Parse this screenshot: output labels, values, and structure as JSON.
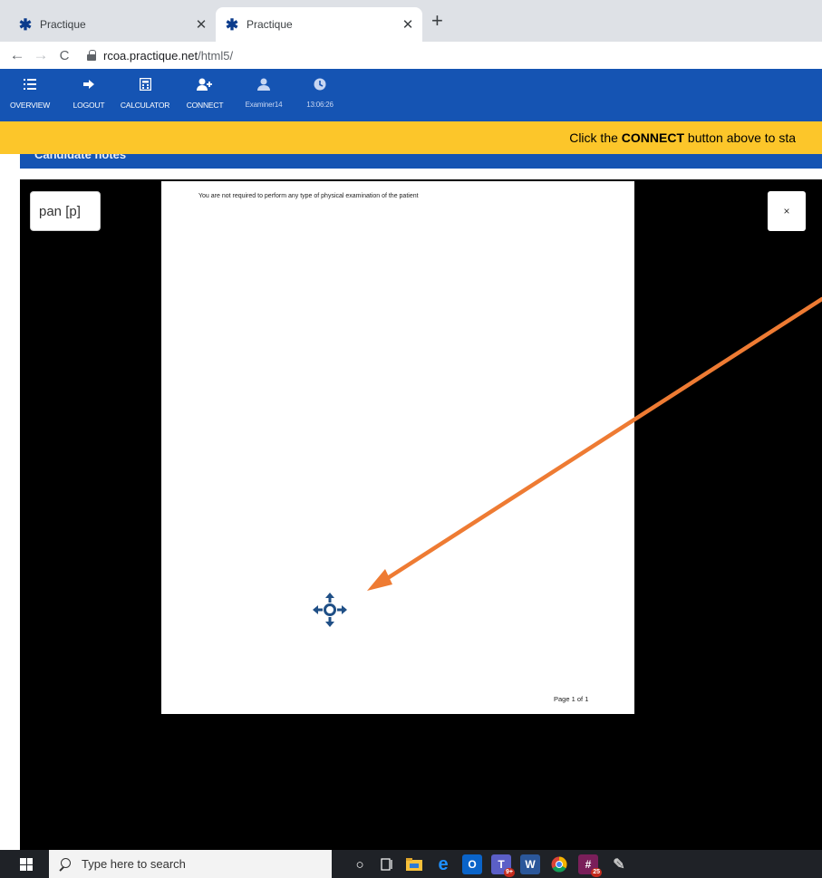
{
  "browser": {
    "tabs": [
      {
        "title": "Practique"
      },
      {
        "title": "Practique"
      }
    ],
    "url_host": "rcoa.practique.net",
    "url_path": "/html5/"
  },
  "toolbar": {
    "items": [
      {
        "icon": "list-icon",
        "label": "OVERVIEW"
      },
      {
        "icon": "logout-icon",
        "label": "LOGOUT"
      },
      {
        "icon": "calculator-icon",
        "label": "CALCULATOR"
      },
      {
        "icon": "add-user-icon",
        "label": "CONNECT"
      },
      {
        "icon": "user-icon",
        "label": "Examiner14"
      },
      {
        "icon": "clock-icon",
        "label": "13:06:26"
      }
    ]
  },
  "banner": {
    "prefix": "Click the ",
    "bold": "CONNECT",
    "suffix": " button above to sta"
  },
  "notes_header": "Candidate notes",
  "viewer": {
    "pan_label": "pan [p]",
    "close_label": "×",
    "page_text": "You are not required to perform any type of physical examination of the patient",
    "page_footer": "Page 1 of 1"
  },
  "taskbar": {
    "search_placeholder": "Type here to search",
    "teams_badge": "9+",
    "slack_badge": "25"
  },
  "colors": {
    "toolbar": "#1554b3",
    "banner": "#fcc62a",
    "annotation_arrow": "#ee7b33",
    "move_icon": "#1f4f86"
  }
}
